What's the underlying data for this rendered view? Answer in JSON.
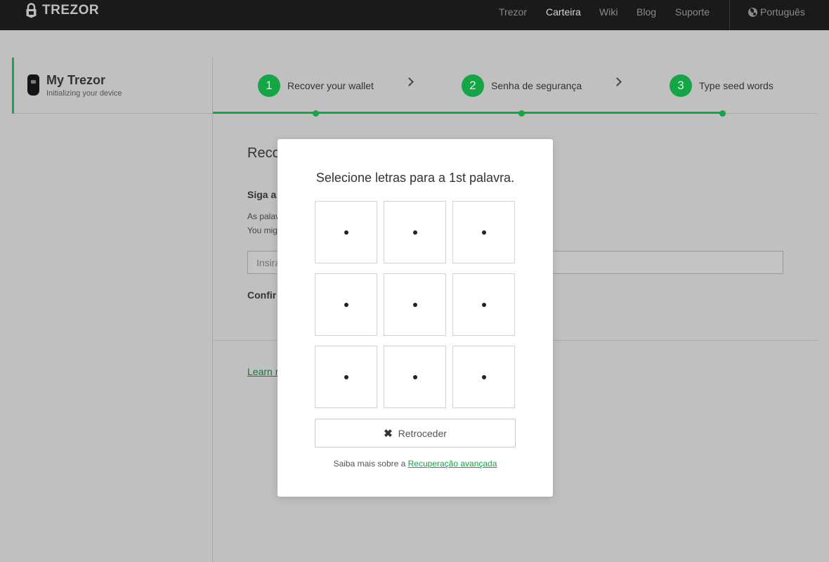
{
  "brand": {
    "name": "TREZOR"
  },
  "nav": {
    "items": [
      "Trezor",
      "Carteira",
      "Wiki",
      "Blog",
      "Suporte"
    ],
    "active": "Carteira",
    "language": "Português"
  },
  "sidebar": {
    "device_name": "My Trezor",
    "device_status": "Initializing your device"
  },
  "steps": [
    {
      "num": "1",
      "label": "Recover your wallet"
    },
    {
      "num": "2",
      "label": "Senha de segurança"
    },
    {
      "num": "3",
      "label": "Type seed words"
    }
  ],
  "content": {
    "title": "Reco",
    "subtitle": "Siga a",
    "line1": "As palav",
    "line2": "You mig",
    "input_placeholder": "Insira",
    "confirm": "Confir",
    "learn_link": "Learn m"
  },
  "modal": {
    "title": "Selecione letras para a 1st palavra.",
    "back_label": "Retroceder",
    "help_text": "Saiba mais sobre a ",
    "help_link": "Recuperação avançada"
  },
  "colors": {
    "accent": "#13a546",
    "topbar": "#1a1a1a",
    "overlay": "#bfbfbf"
  }
}
